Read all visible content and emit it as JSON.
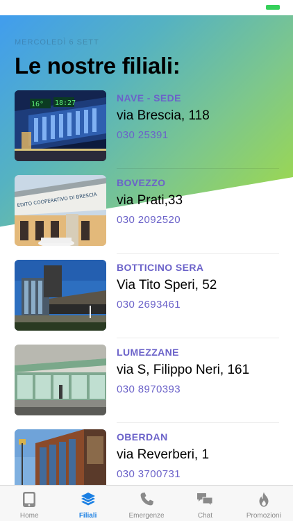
{
  "header": {
    "date_label": "MERCOLEDÌ 6 SETT",
    "title": "Le nostre filiali:"
  },
  "branches": [
    {
      "name": "NAVE - SEDE",
      "address": "via Brescia, 118",
      "phone": "030 25391",
      "photo": "night-building-photo"
    },
    {
      "name": "BOVEZZO",
      "address": "via Prati,33",
      "phone": "030 2092520",
      "photo": "bank-facade-photo"
    },
    {
      "name": "BOTTICINO SERA",
      "address": "Via Tito Speri, 52",
      "phone": "030 2693461",
      "photo": "modern-building-photo"
    },
    {
      "name": "LUMEZZANE",
      "address": "via S, Filippo Neri, 161",
      "phone": "030 8970393",
      "photo": "glass-storefront-photo"
    },
    {
      "name": "OBERDAN",
      "address": "via Reverberi, 1",
      "phone": "030 3700731",
      "photo": "brick-glass-building-photo"
    }
  ],
  "tabbar": {
    "tabs": [
      {
        "label": "Home",
        "icon": "tablet-icon",
        "active": false
      },
      {
        "label": "Filiali",
        "icon": "layers-icon",
        "active": true
      },
      {
        "label": "Emergenze",
        "icon": "phone-icon",
        "active": false
      },
      {
        "label": "Chat",
        "icon": "chat-bubbles-icon",
        "active": false
      },
      {
        "label": "Promozioni",
        "icon": "flame-icon",
        "active": false
      }
    ]
  },
  "colors": {
    "accent": "#6b62c9",
    "tab_active": "#1a7fe3",
    "tab_inactive": "#8a8a8a",
    "battery": "#35d05a",
    "gradient_start": "#3f9bf2",
    "gradient_end": "#a6dd3d"
  }
}
